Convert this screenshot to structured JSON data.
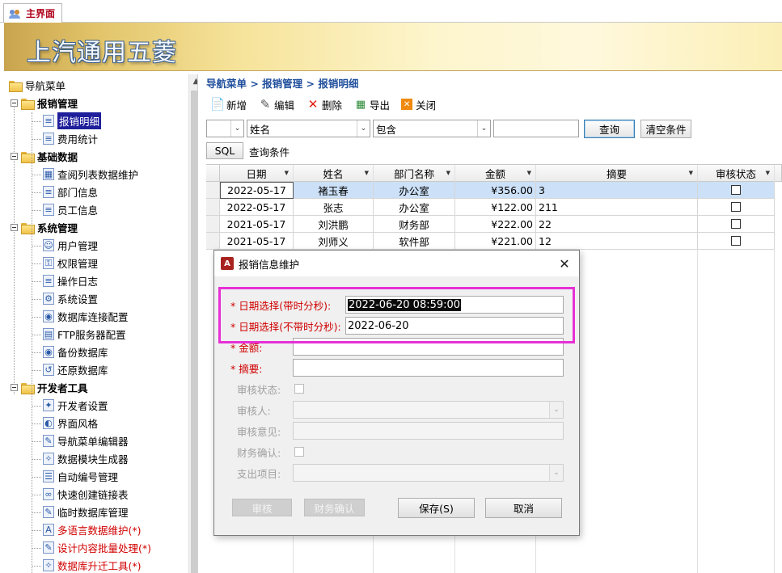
{
  "tab": {
    "label": "主界面"
  },
  "banner": {
    "title": "上汽通用五菱"
  },
  "nav": {
    "root": "导航菜单",
    "items": [
      {
        "label": "报销管理",
        "type": "group"
      },
      {
        "label": "报销明细",
        "type": "leaf",
        "icon": "document-icon",
        "selected": true
      },
      {
        "label": "费用统计",
        "type": "leaf",
        "icon": "document-icon"
      },
      {
        "label": "基础数据",
        "type": "group"
      },
      {
        "label": "查阅列表数据维护",
        "type": "leaf",
        "icon": "table-icon"
      },
      {
        "label": "部门信息",
        "type": "leaf",
        "icon": "document-icon"
      },
      {
        "label": "员工信息",
        "type": "leaf",
        "icon": "document-icon"
      },
      {
        "label": "系统管理",
        "type": "group"
      },
      {
        "label": "用户管理",
        "type": "leaf",
        "icon": "users-icon"
      },
      {
        "label": "权限管理",
        "type": "leaf",
        "icon": "lock-icon"
      },
      {
        "label": "操作日志",
        "type": "leaf",
        "icon": "document-icon"
      },
      {
        "label": "系统设置",
        "type": "leaf",
        "icon": "settings-icon"
      },
      {
        "label": "数据库连接配置",
        "type": "leaf",
        "icon": "database-icon"
      },
      {
        "label": "FTP服务器配置",
        "type": "leaf",
        "icon": "server-icon"
      },
      {
        "label": "备份数据库",
        "type": "leaf",
        "icon": "database-icon"
      },
      {
        "label": "还原数据库",
        "type": "leaf",
        "icon": "restore-icon"
      },
      {
        "label": "开发者工具",
        "type": "group"
      },
      {
        "label": "开发者设置",
        "type": "leaf",
        "icon": "puzzle-icon"
      },
      {
        "label": "界面风格",
        "type": "leaf",
        "icon": "palette-icon"
      },
      {
        "label": "导航菜单编辑器",
        "type": "leaf",
        "icon": "edit-icon"
      },
      {
        "label": "数据模块生成器",
        "type": "leaf",
        "icon": "wand-icon"
      },
      {
        "label": "自动编号管理",
        "type": "leaf",
        "icon": "list-icon"
      },
      {
        "label": "快速创建链接表",
        "type": "leaf",
        "icon": "link-icon"
      },
      {
        "label": "临时数据库管理",
        "type": "leaf",
        "icon": "edit-icon"
      },
      {
        "label": "多语言数据维护(*)",
        "type": "leaf",
        "icon": "language-icon",
        "red": true
      },
      {
        "label": "设计内容批量处理(*)",
        "type": "leaf",
        "icon": "edit-icon",
        "red": true
      },
      {
        "label": "数据库升迁工具(*)",
        "type": "leaf",
        "icon": "wand-icon",
        "red": true
      }
    ]
  },
  "breadcrumb": "导航菜单 > 报销管理 > 报销明细",
  "toolbar": {
    "new_label": "新增",
    "edit_label": "编辑",
    "delete_label": "删除",
    "export_label": "导出",
    "close_label": "关闭"
  },
  "filter": {
    "field_value": "姓名",
    "operator_value": "包含",
    "query_label": "查询",
    "clear_label": "清空条件"
  },
  "sql": {
    "button_label": "SQL",
    "text": "查询条件"
  },
  "grid": {
    "columns": [
      "日期",
      "姓名",
      "部门名称",
      "金额",
      "摘要",
      "审核状态"
    ],
    "rows": [
      {
        "date": "2022-05-17",
        "name": "褚玉春",
        "dept": "办公室",
        "amount": "¥356.00",
        "summary": "3",
        "audited": false
      },
      {
        "date": "2022-05-17",
        "name": "张志",
        "dept": "办公室",
        "amount": "¥122.00",
        "summary": "211",
        "audited": false
      },
      {
        "date": "2021-05-17",
        "name": "刘洪鹏",
        "dept": "财务部",
        "amount": "¥222.00",
        "summary": "22",
        "audited": false
      },
      {
        "date": "2021-05-17",
        "name": "刘师义",
        "dept": "软件部",
        "amount": "¥221.00",
        "summary": "12",
        "audited": false
      }
    ]
  },
  "dialog": {
    "title": "报销信息维护",
    "fields": {
      "datetime_label": "* 日期选择(带时分秒):",
      "datetime_value": "2022-06-20 08:59:00",
      "date_label": "* 日期选择(不带时分秒):",
      "date_value": "2022-06-20",
      "amount_label": "* 金额:",
      "summary_label": "* 摘要:",
      "audit_status_label": "审核状态:",
      "auditor_label": "审核人:",
      "audit_opinion_label": "审核意见:",
      "finance_confirm_label": "财务确认:",
      "expense_item_label": "支出项目:"
    },
    "buttons": {
      "audit_label": "审核",
      "finance_confirm_label": "财务确认",
      "save_label": "保存(S)",
      "cancel_label": "取消"
    }
  },
  "colors": {
    "accent_red": "#d00000",
    "highlight": "#e630d6",
    "selection": "#1f1f9c",
    "breadcrumb": "#1f4e9c"
  }
}
